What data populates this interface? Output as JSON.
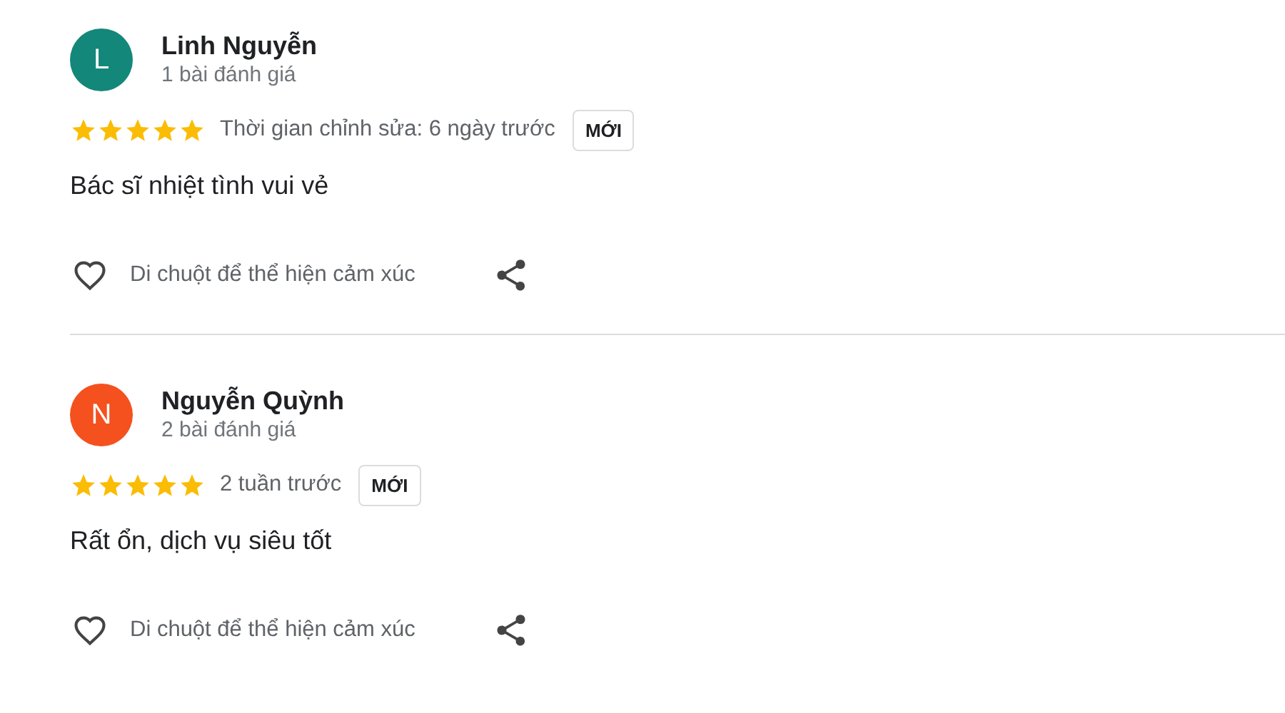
{
  "reviews": [
    {
      "avatar_letter": "L",
      "color": "#13877a",
      "name": "Linh Nguyễn",
      "review_count": "1 bài đánh giá",
      "stars": 5,
      "time": "Thời gian chỉnh sửa: 6 ngày trước",
      "badge": "MỚI",
      "text": "Bác sĩ nhiệt tình vui vẻ",
      "reaction_hint": "Di chuột để thể hiện cảm xúc"
    },
    {
      "avatar_letter": "N",
      "color": "#f4511e",
      "name": "Nguyễn Quỳnh",
      "review_count": "2 bài đánh giá",
      "stars": 5,
      "time": "2 tuần trước",
      "badge": "MỚI",
      "text": "Rất ổn, dịch vụ siêu tốt",
      "reaction_hint": "Di chuột để thể hiện cảm xúc"
    }
  ]
}
